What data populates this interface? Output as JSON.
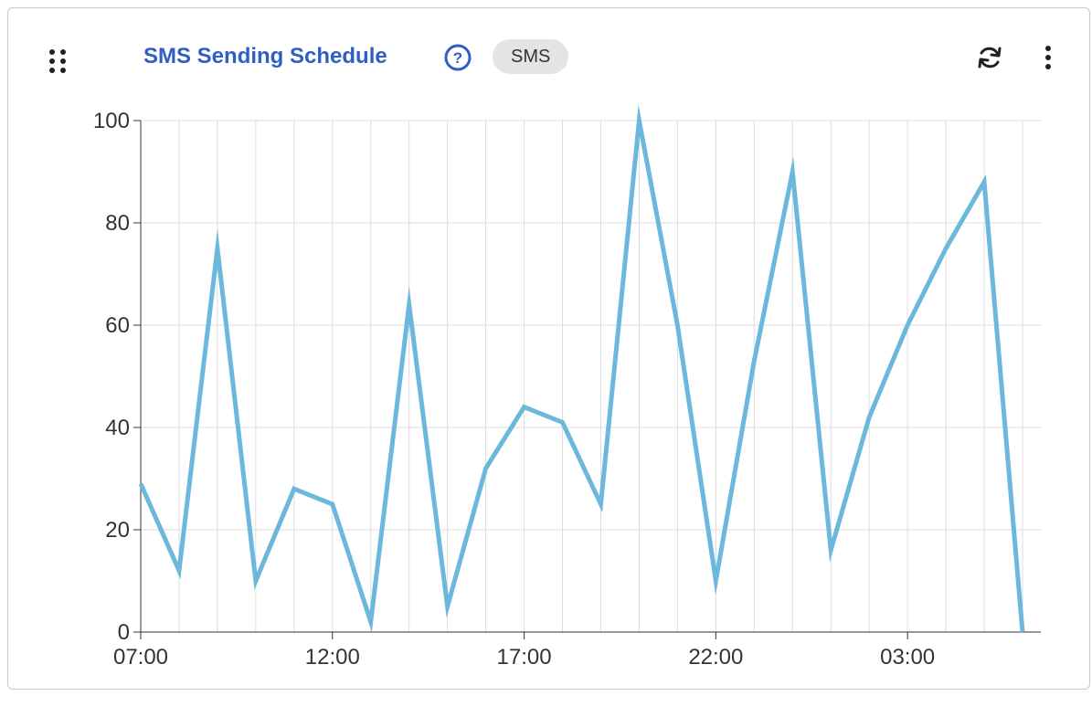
{
  "header": {
    "title": "SMS Sending Schedule",
    "badge": "SMS",
    "icons": {
      "drag": "drag-handle-icon",
      "help": "help-icon",
      "refresh": "refresh-icon",
      "more": "more-vertical-icon"
    }
  },
  "colors": {
    "title": "#2f5fc4",
    "line": "#6cb8dc",
    "grid": "#dcdcdc",
    "axis": "#333333",
    "badge_bg": "#e4e4e4"
  },
  "chart_data": {
    "type": "line",
    "title": "",
    "xlabel": "",
    "ylabel": "",
    "x": [
      "07:00",
      "08:00",
      "09:00",
      "10:00",
      "11:00",
      "12:00",
      "13:00",
      "14:00",
      "15:00",
      "16:00",
      "17:00",
      "18:00",
      "19:00",
      "20:00",
      "21:00",
      "22:00",
      "23:00",
      "00:00",
      "01:00",
      "02:00",
      "03:00",
      "04:00",
      "05:00",
      "06:00"
    ],
    "x_tick_labels": [
      "07:00",
      "12:00",
      "17:00",
      "22:00",
      "03:00"
    ],
    "series": [
      {
        "values": [
          29,
          12,
          75,
          10,
          28,
          25,
          2,
          64,
          5,
          32,
          44,
          41,
          25,
          100,
          60,
          10,
          53,
          90,
          16,
          42,
          60,
          75,
          88,
          0
        ]
      }
    ],
    "y_ticks": [
      0,
      20,
      40,
      60,
      80,
      100
    ],
    "ylim": [
      0,
      100
    ],
    "grid": true,
    "legend": "none"
  }
}
